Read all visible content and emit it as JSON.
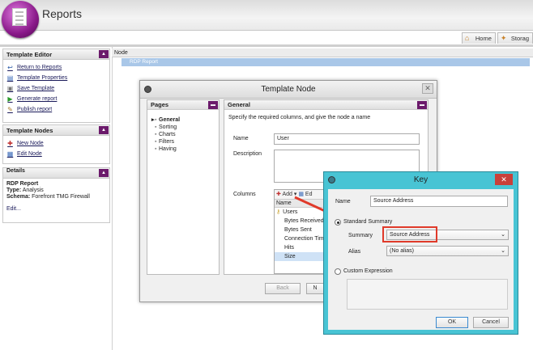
{
  "app": {
    "title": "Reports"
  },
  "nav_tabs": [
    {
      "label": "Home",
      "icon": "home-icon"
    },
    {
      "label": "Storag",
      "icon": "storage-icon"
    }
  ],
  "sidebar": {
    "template_editor": {
      "title": "Template Editor",
      "items": [
        {
          "label": "Return to Reports",
          "icon": "return-icon"
        },
        {
          "label": "Template Properties",
          "icon": "properties-icon"
        },
        {
          "label": "Save Template",
          "icon": "save-icon"
        },
        {
          "label": "Generate report",
          "icon": "play-icon"
        },
        {
          "label": "Publish report",
          "icon": "publish-icon"
        }
      ]
    },
    "template_nodes": {
      "title": "Template Nodes",
      "items": [
        {
          "label": "New Node",
          "icon": "new-node-icon"
        },
        {
          "label": "Edit Node",
          "icon": "edit-node-icon"
        }
      ]
    },
    "details": {
      "title": "Details",
      "name": "RDP Report",
      "type_label": "Type:",
      "type_value": "Analysis",
      "schema_label": "Schema:",
      "schema_value": "Forefront TMG Firewall",
      "edit": "Edit..."
    }
  },
  "node_panel": {
    "header": "Node",
    "tree_item": "RDP Report"
  },
  "template_node": {
    "title": "Template Node",
    "pages_title": "Pages",
    "pages": [
      "General",
      "Sorting",
      "Charts",
      "Filters",
      "Having"
    ],
    "general_title": "General",
    "instruction": "Specify the required columns, and give the node a name",
    "name_label": "Name",
    "name_value": "User",
    "description_label": "Description",
    "columns_label": "Columns",
    "columns_toolbar_add": "Add",
    "columns_toolbar_edit": "Ed",
    "columns_header": "Name",
    "columns": [
      "Users",
      "Bytes Received",
      "Bytes Sent",
      "Connection Tim",
      "Hits",
      "Size"
    ],
    "back_button": "Back",
    "next_button": "N"
  },
  "key_dialog": {
    "title": "Key",
    "name_label": "Name",
    "name_value": "Source Address",
    "standard_summary_label": "Standard Summary",
    "summary_label": "Summary",
    "summary_value": "Source Address",
    "alias_label": "Alias",
    "alias_value": "(No alias)",
    "custom_expression_label": "Custom Expression",
    "ok_button": "OK",
    "cancel_button": "Cancel"
  },
  "colors": {
    "accent": "#6b1a6b",
    "key_frame": "#48c4d4",
    "highlight": "#e03a2a",
    "selection": "#a9c7e8"
  }
}
